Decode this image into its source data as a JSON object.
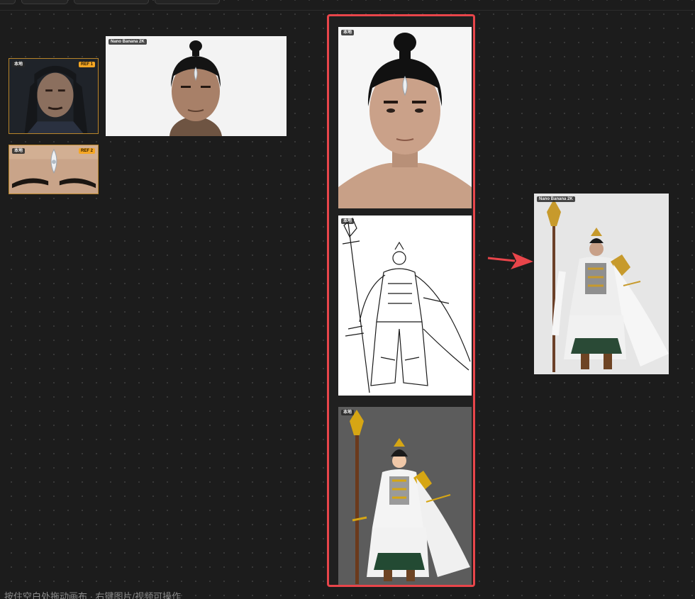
{
  "canvas": {
    "hint_text": "按住空白处拖动画布 · 右键图片/视频可操作"
  },
  "nodes": {
    "ref1": {
      "tag": "本地",
      "badge": "REF 1"
    },
    "ref2": {
      "tag": "本地",
      "badge": "REF 2"
    },
    "portrait_gen": {
      "tag": "Nano Banana 2K"
    },
    "stack_face": {
      "tag": "本地"
    },
    "stack_sketch": {
      "tag": "本地"
    },
    "stack_flat": {
      "tag": "本地"
    },
    "result": {
      "tag": "Nano Banana 2K"
    }
  },
  "colors": {
    "selection_border": "#e8454a",
    "ref_badge": "#f5a623",
    "arrow": "#e8454a"
  },
  "icons": {
    "arrow": "right-arrow-icon"
  }
}
